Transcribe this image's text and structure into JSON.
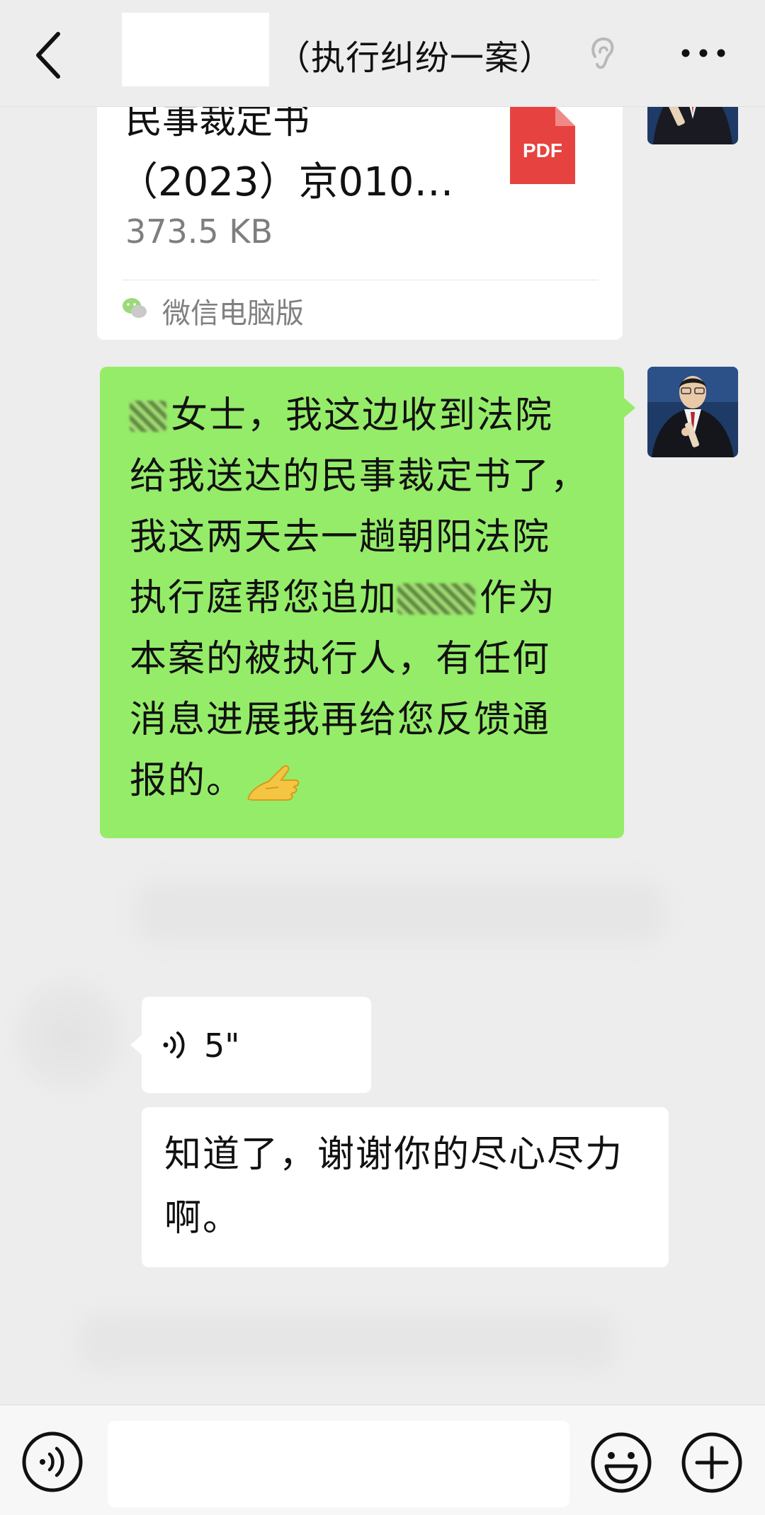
{
  "header": {
    "title": "（执行纠纷一案）",
    "back_icon": "chevron-left-icon",
    "ear_icon": "ear-icon",
    "more_icon": "more-horizontal-icon"
  },
  "file_card": {
    "name_line1": "民事裁定书",
    "name_line2": "（2023）京010…",
    "size": "373.5 KB",
    "file_type_label": "PDF",
    "source": "微信电脑版"
  },
  "outgoing_message": {
    "line1_suffix": "女士，我这边收到法院",
    "line2": "给我送达的民事裁定书了，",
    "line3": "我这两天去一趟朝阳法院",
    "line4_prefix": "执行庭帮您追加",
    "line4_suffix": "作为",
    "line5": "本案的被执行人，有任何",
    "line6": "消息进展我再给您反馈通",
    "line7": "报的。"
  },
  "incoming_voice": {
    "duration": "5\""
  },
  "incoming_message": {
    "text": "知道了，谢谢你的尽心尽力啊。"
  },
  "input_bar": {
    "voice_icon": "voice-toggle-icon",
    "emoji_icon": "emoji-icon",
    "plus_icon": "plus-circle-icon"
  },
  "colors": {
    "background": "#ededed",
    "outgoing_bubble": "#95ec69",
    "incoming_bubble": "#ffffff",
    "pdf_red": "#e64340",
    "secondary_text": "#808080"
  }
}
